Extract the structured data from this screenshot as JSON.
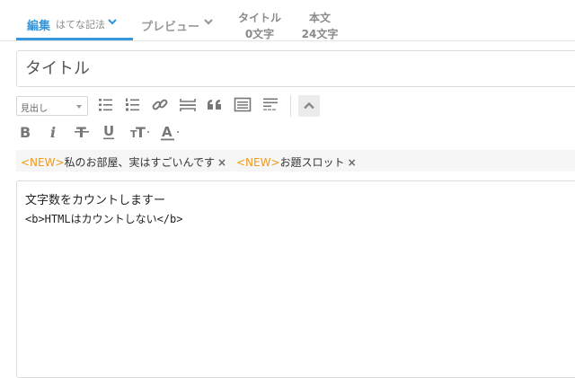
{
  "tabs": {
    "edit": {
      "label": "編集",
      "sublabel": "はてな記法"
    },
    "preview": {
      "label": "プレビュー"
    }
  },
  "counters": [
    {
      "name": "タイトル",
      "value": "0文字"
    },
    {
      "name": "本文",
      "value": "24文字"
    }
  ],
  "title_field": {
    "placeholder": "タイトル",
    "value": ""
  },
  "toolbar": {
    "heading_select": "見出し",
    "buttons": [
      {
        "icon": "bullet-list-icon"
      },
      {
        "icon": "numbered-list-icon"
      },
      {
        "icon": "link-icon"
      },
      {
        "icon": "horizontal-rule-icon"
      },
      {
        "icon": "quote-icon"
      },
      {
        "icon": "table-icon"
      },
      {
        "icon": "read-more-icon"
      },
      {
        "icon": "collapse-up-icon"
      }
    ],
    "format_buttons": [
      {
        "icon": "bold-icon"
      },
      {
        "icon": "italic-icon"
      },
      {
        "icon": "strikethrough-icon"
      },
      {
        "icon": "underline-icon"
      },
      {
        "icon": "font-size-icon"
      },
      {
        "icon": "font-color-icon"
      }
    ]
  },
  "topics": [
    {
      "badge": "<NEW>",
      "text": "私のお部屋、実はすごいんです",
      "close": "×"
    },
    {
      "badge": "<NEW>",
      "text": "お題スロット",
      "close": "×"
    }
  ],
  "editor": {
    "lines": [
      "文字数をカウントしますー",
      "<b>HTMLはカウントしない</b>"
    ]
  },
  "colors": {
    "accent": "#3598db",
    "badge_new": "#f09a1a",
    "muted": "#999999",
    "border": "#dcdcdc"
  }
}
